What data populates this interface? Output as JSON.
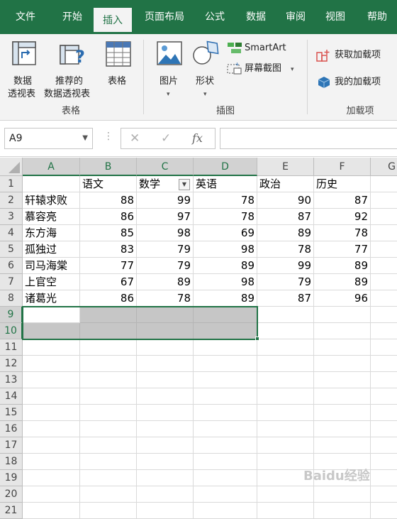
{
  "tabs": [
    "文件",
    "开始",
    "插入",
    "页面布局",
    "公式",
    "数据",
    "审阅",
    "视图",
    "帮助"
  ],
  "active_tab": "插入",
  "ribbon": {
    "groups": {
      "tables": "表格",
      "illustrations": "插图",
      "addins": "加载项"
    },
    "pivot_table": [
      "数据",
      "透视表"
    ],
    "recommended_pivot": [
      "推荐的",
      "数据透视表"
    ],
    "table": "表格",
    "pictures": "图片",
    "shapes": "形状",
    "smartart": "SmartArt",
    "screenshot": "屏幕截图",
    "get_addins": "获取加载项",
    "my_addins": "我的加载项"
  },
  "formula_bar": {
    "name_box": "A9",
    "fx": "fx",
    "formula": ""
  },
  "sheet": {
    "columns": [
      "A",
      "B",
      "C",
      "D",
      "E",
      "F",
      "G"
    ],
    "row_numbers": [
      "1",
      "2",
      "3",
      "4",
      "5",
      "6",
      "7",
      "8",
      "9",
      "10",
      "11",
      "12",
      "13",
      "14",
      "15",
      "16",
      "17",
      "18",
      "19",
      "20",
      "21"
    ],
    "headers": [
      "",
      "语文",
      "数学",
      "英语",
      "政治",
      "历史"
    ],
    "rows": [
      [
        "轩辕求败",
        "88",
        "99",
        "78",
        "90",
        "87"
      ],
      [
        "慕容亮",
        "86",
        "97",
        "78",
        "87",
        "92"
      ],
      [
        "东方海",
        "85",
        "98",
        "69",
        "89",
        "78"
      ],
      [
        "孤独过",
        "83",
        "79",
        "98",
        "78",
        "77"
      ],
      [
        "司马海棠",
        "77",
        "79",
        "89",
        "99",
        "89"
      ],
      [
        "上官空",
        "67",
        "89",
        "98",
        "79",
        "89"
      ],
      [
        "诸葛光",
        "86",
        "78",
        "89",
        "87",
        "96"
      ]
    ]
  },
  "watermark": "Baidu经验",
  "colors": {
    "accent": "#217346",
    "selection": "#c6c6c6"
  }
}
